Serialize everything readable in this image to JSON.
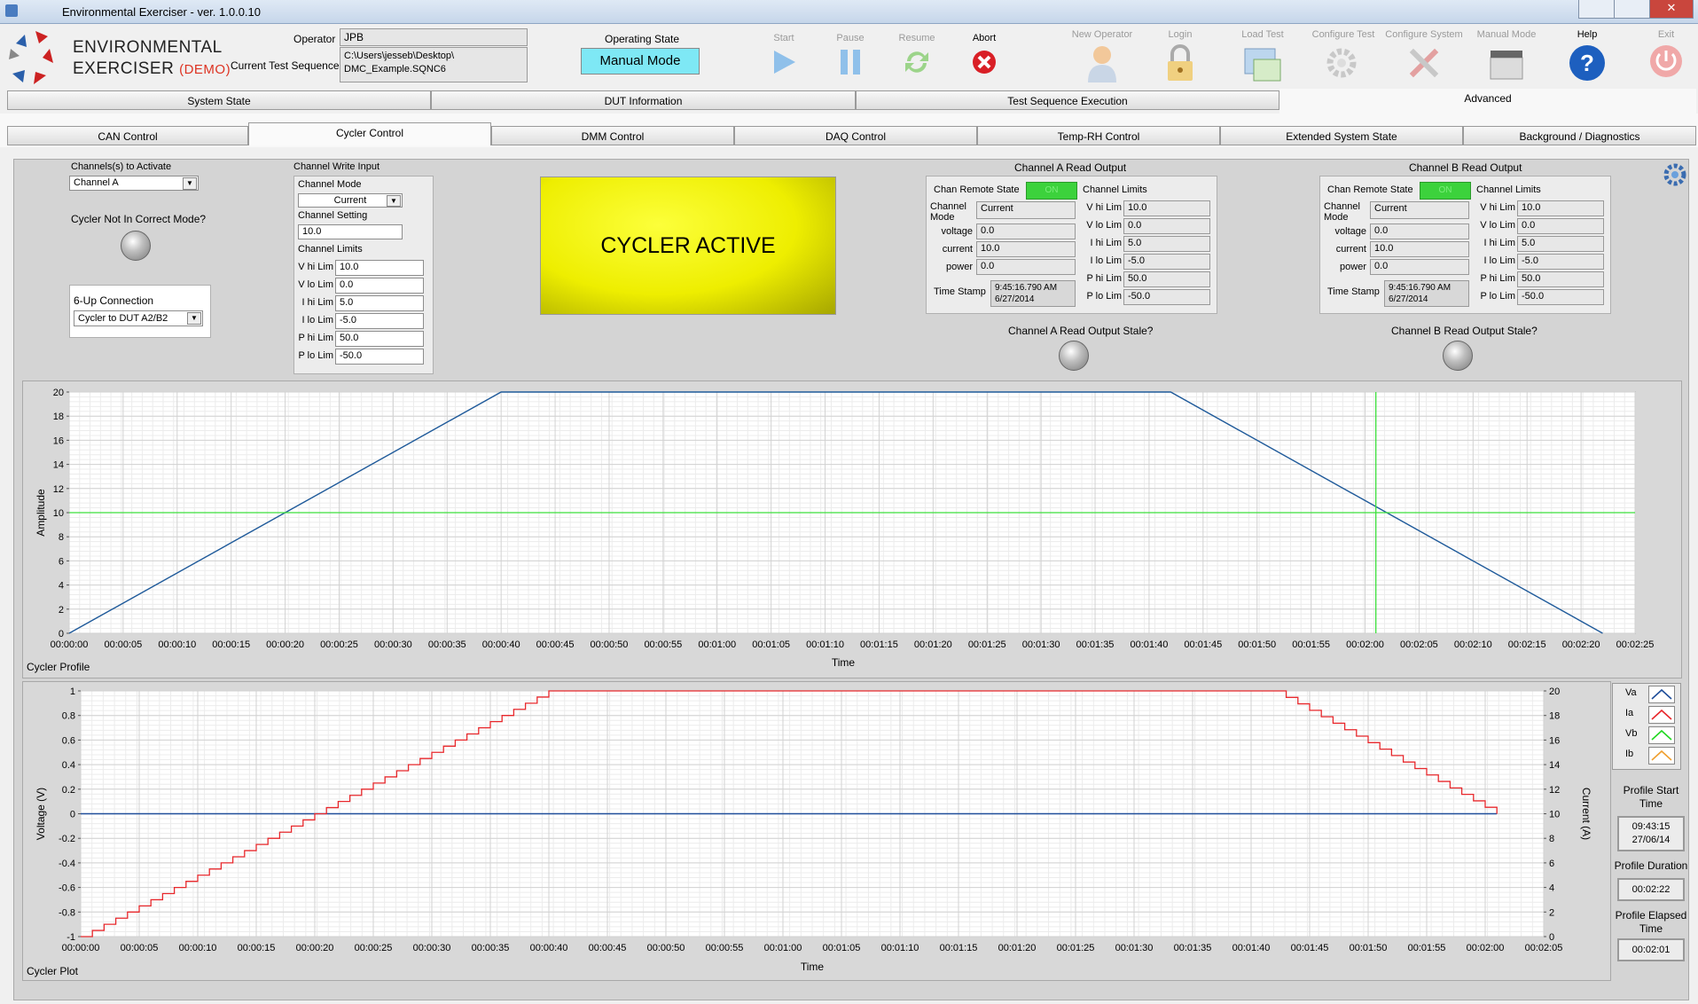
{
  "window": {
    "title": "Environmental Exerciser - ver. 1.0.0.10"
  },
  "logo": {
    "line1": "ENVIRONMENTAL",
    "line2": "EXERCISER",
    "demo": "(DEMO)"
  },
  "header": {
    "operator_label": "Operator",
    "operator_value": "JPB",
    "sequence_label": "Current Test Sequence",
    "sequence_value_line1": "C:\\Users\\jesseb\\Desktop\\",
    "sequence_value_line2": "DMC_Example.SQNC6",
    "state_label": "Operating State",
    "state_value": "Manual Mode"
  },
  "toolbar": {
    "start": "Start",
    "pause": "Pause",
    "resume": "Resume",
    "abort": "Abort",
    "new_operator": "New Operator",
    "login": "Login",
    "load_test": "Load Test",
    "configure_test": "Configure Test",
    "configure_system": "Configure System",
    "manual_mode": "Manual Mode",
    "help": "Help",
    "exit": "Exit"
  },
  "main_tabs": [
    "System State",
    "DUT Information",
    "Test Sequence Execution",
    "Advanced"
  ],
  "sub_tabs": [
    "CAN Control",
    "Cycler Control",
    "DMM Control",
    "DAQ Control",
    "Temp-RH Control",
    "Extended System State",
    "Background / Diagnostics"
  ],
  "left": {
    "channels_label": "Channels(s) to Activate",
    "channels_value": "Channel A",
    "not_mode_label": "Cycler Not In Correct Mode?",
    "sixup_label": "6-Up Connection",
    "sixup_value": "Cycler to DUT A2/B2"
  },
  "write": {
    "title": "Channel Write Input",
    "mode_label": "Channel Mode",
    "mode_value": "Current",
    "setting_label": "Channel Setting",
    "setting_value": "10.0",
    "limits_label": "Channel Limits",
    "limits": [
      {
        "label": "V hi Lim",
        "value": "10.0"
      },
      {
        "label": "V lo Lim",
        "value": "0.0"
      },
      {
        "label": "I hi Lim",
        "value": "5.0"
      },
      {
        "label": "I lo Lim",
        "value": "-5.0"
      },
      {
        "label": "P hi Lim",
        "value": "50.0"
      },
      {
        "label": "P lo Lim",
        "value": "-50.0"
      }
    ]
  },
  "status_banner": "CYCLER ACTIVE",
  "channel_a": {
    "title": "Channel A Read Output",
    "remote_label": "Chan Remote State",
    "remote_value": "ON",
    "mode_label": "Channel Mode",
    "mode_value": "Current",
    "voltage_label": "voltage",
    "voltage_value": "0.0",
    "current_label": "current",
    "current_value": "10.0",
    "power_label": "power",
    "power_value": "0.0",
    "ts_label": "Time Stamp",
    "ts_time": "9:45:16.790 AM",
    "ts_date": "6/27/2014",
    "limits_label": "Channel Limits",
    "limits": [
      {
        "label": "V hi Lim",
        "value": "10.0"
      },
      {
        "label": "V lo Lim",
        "value": "0.0"
      },
      {
        "label": "I hi Lim",
        "value": "5.0"
      },
      {
        "label": "I lo Lim",
        "value": "-5.0"
      },
      {
        "label": "P hi Lim",
        "value": "50.0"
      },
      {
        "label": "P lo Lim",
        "value": "-50.0"
      }
    ],
    "stale_label": "Channel A Read Output Stale?"
  },
  "channel_b": {
    "title": "Channel B Read Output",
    "remote_label": "Chan Remote State",
    "remote_value": "ON",
    "mode_label": "Channel Mode",
    "mode_value": "Current",
    "voltage_label": "voltage",
    "voltage_value": "0.0",
    "current_label": "current",
    "current_value": "10.0",
    "power_label": "power",
    "power_value": "0.0",
    "ts_label": "Time Stamp",
    "ts_time": "9:45:16.790 AM",
    "ts_date": "6/27/2014",
    "limits_label": "Channel Limits",
    "limits": [
      {
        "label": "V hi Lim",
        "value": "10.0"
      },
      {
        "label": "V lo Lim",
        "value": "0.0"
      },
      {
        "label": "I hi Lim",
        "value": "5.0"
      },
      {
        "label": "I lo Lim",
        "value": "-5.0"
      },
      {
        "label": "P hi Lim",
        "value": "50.0"
      },
      {
        "label": "P lo Lim",
        "value": "-50.0"
      }
    ],
    "stale_label": "Channel B Read Output Stale?"
  },
  "profile_chart": {
    "caption": "Cycler Profile",
    "xlabel": "Time",
    "ylabel": "Amplitude",
    "yticks": [
      "0",
      "2",
      "4",
      "6",
      "8",
      "10",
      "12",
      "14",
      "16",
      "18",
      "20"
    ],
    "xticks": [
      "00:00:00",
      "00:00:05",
      "00:00:10",
      "00:00:15",
      "00:00:20",
      "00:00:25",
      "00:00:30",
      "00:00:35",
      "00:00:40",
      "00:00:45",
      "00:00:50",
      "00:00:55",
      "00:01:00",
      "00:01:05",
      "00:01:10",
      "00:01:15",
      "00:01:20",
      "00:01:25",
      "00:01:30",
      "00:01:35",
      "00:01:40",
      "00:01:45",
      "00:01:50",
      "00:01:55",
      "00:02:00",
      "00:02:05",
      "00:02:10",
      "00:02:15",
      "00:02:20",
      "00:02:25"
    ],
    "cursor_x": 121,
    "cursor_y": 10
  },
  "plot_chart": {
    "caption": "Cycler Plot",
    "xlabel": "Time",
    "ylabel_left": "Voltage (V)",
    "ylabel_right": "Current (A)",
    "yticks_left": [
      "-1",
      "-0.8",
      "-0.6",
      "-0.4",
      "-0.2",
      "0",
      "0.2",
      "0.4",
      "0.6",
      "0.8",
      "1"
    ],
    "yticks_right": [
      "0",
      "2",
      "4",
      "6",
      "8",
      "10",
      "12",
      "14",
      "16",
      "18",
      "20"
    ],
    "xticks": [
      "00:00:00",
      "00:00:05",
      "00:00:10",
      "00:00:15",
      "00:00:20",
      "00:00:25",
      "00:00:30",
      "00:00:35",
      "00:00:40",
      "00:00:45",
      "00:00:50",
      "00:00:55",
      "00:01:00",
      "00:01:05",
      "00:01:10",
      "00:01:15",
      "00:01:20",
      "00:01:25",
      "00:01:30",
      "00:01:35",
      "00:01:40",
      "00:01:45",
      "00:01:50",
      "00:01:55",
      "00:02:00",
      "00:02:05"
    ],
    "legend": [
      {
        "name": "Va",
        "color": "#1f4e9a"
      },
      {
        "name": "Ia",
        "color": "#e8282c"
      },
      {
        "name": "Vb",
        "color": "#22d822"
      },
      {
        "name": "Ib",
        "color": "#f0a030"
      }
    ]
  },
  "profile_info": {
    "start_label": "Profile Start Time",
    "start_time": "09:43:15",
    "start_date": "27/06/14",
    "duration_label": "Profile Duration",
    "duration_value": "00:02:22",
    "elapsed_label": "Profile Elapsed Time",
    "elapsed_value": "00:02:01"
  },
  "chart_data": [
    {
      "type": "line",
      "title": "Cycler Profile",
      "xlabel": "Time",
      "ylabel": "Amplitude",
      "xlim": [
        0,
        145
      ],
      "ylim": [
        0,
        20
      ],
      "series": [
        {
          "x": [
            0,
            40,
            102,
            142
          ],
          "y": [
            0,
            20,
            20,
            0
          ]
        }
      ],
      "grid": true
    },
    {
      "type": "line",
      "title": "Cycler Plot",
      "xlabel": "Time",
      "ylabel": "Voltage (V)",
      "ylabel_right": "Current (A)",
      "xlim": [
        0,
        125
      ],
      "ylim": [
        -1,
        1
      ],
      "ylim_right": [
        0,
        20
      ],
      "series": [
        {
          "name": "Va",
          "axis": "left",
          "x": [
            0,
            121
          ],
          "y": [
            0,
            0
          ]
        },
        {
          "name": "Ia",
          "axis": "right",
          "x": [
            0,
            40,
            102,
            121
          ],
          "y": [
            0,
            20,
            20,
            10
          ]
        }
      ],
      "grid": true,
      "legend": "right"
    }
  ]
}
